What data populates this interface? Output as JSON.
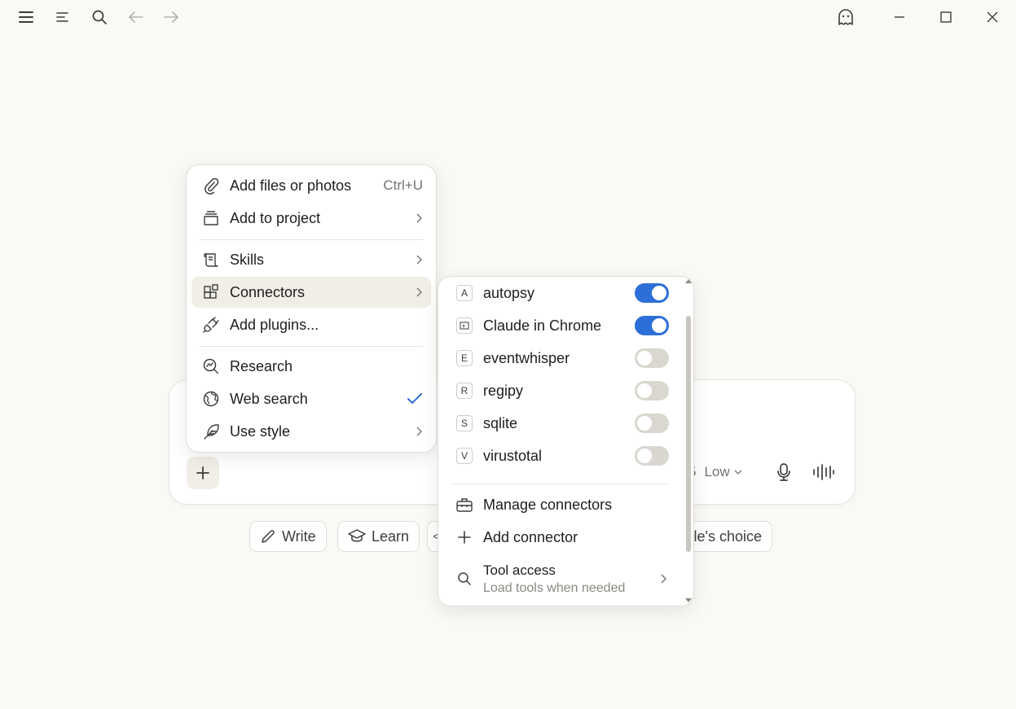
{
  "composer": {
    "effort_label": "Low",
    "effort_prefix_fragment": "5"
  },
  "chips": {
    "write": "Write",
    "learn": "Learn",
    "partial_left": "<",
    "partial_right": "le's choice"
  },
  "attach_menu": {
    "items": [
      {
        "label": "Add files or photos",
        "shortcut": "Ctrl+U",
        "icon": "paperclip-icon"
      },
      {
        "label": "Add to project",
        "icon": "project-icon"
      },
      {
        "label": "Skills",
        "icon": "skills-icon"
      },
      {
        "label": "Connectors",
        "icon": "connectors-icon"
      },
      {
        "label": "Add plugins...",
        "icon": "plug-icon"
      },
      {
        "label": "Research",
        "icon": "research-icon"
      },
      {
        "label": "Web search",
        "icon": "globe-icon"
      },
      {
        "label": "Use style",
        "icon": "feather-icon"
      }
    ]
  },
  "connectors_menu": {
    "connectors": [
      {
        "letter": "A",
        "name": "autopsy",
        "enabled": true
      },
      {
        "letter": "",
        "name": "Claude in Chrome",
        "enabled": true
      },
      {
        "letter": "E",
        "name": "eventwhisper",
        "enabled": false
      },
      {
        "letter": "R",
        "name": "regipy",
        "enabled": false
      },
      {
        "letter": "S",
        "name": "sqlite",
        "enabled": false
      },
      {
        "letter": "V",
        "name": "virustotal",
        "enabled": false
      }
    ],
    "manage": "Manage connectors",
    "add": "Add connector",
    "tool_access": "Tool access",
    "tool_access_sub": "Load tools when needed"
  },
  "colors": {
    "background": "#FAF9F5",
    "toggle_on": "#2D6FD9",
    "toggle_off": "#D9D7D0",
    "check": "#2D6FD9"
  }
}
